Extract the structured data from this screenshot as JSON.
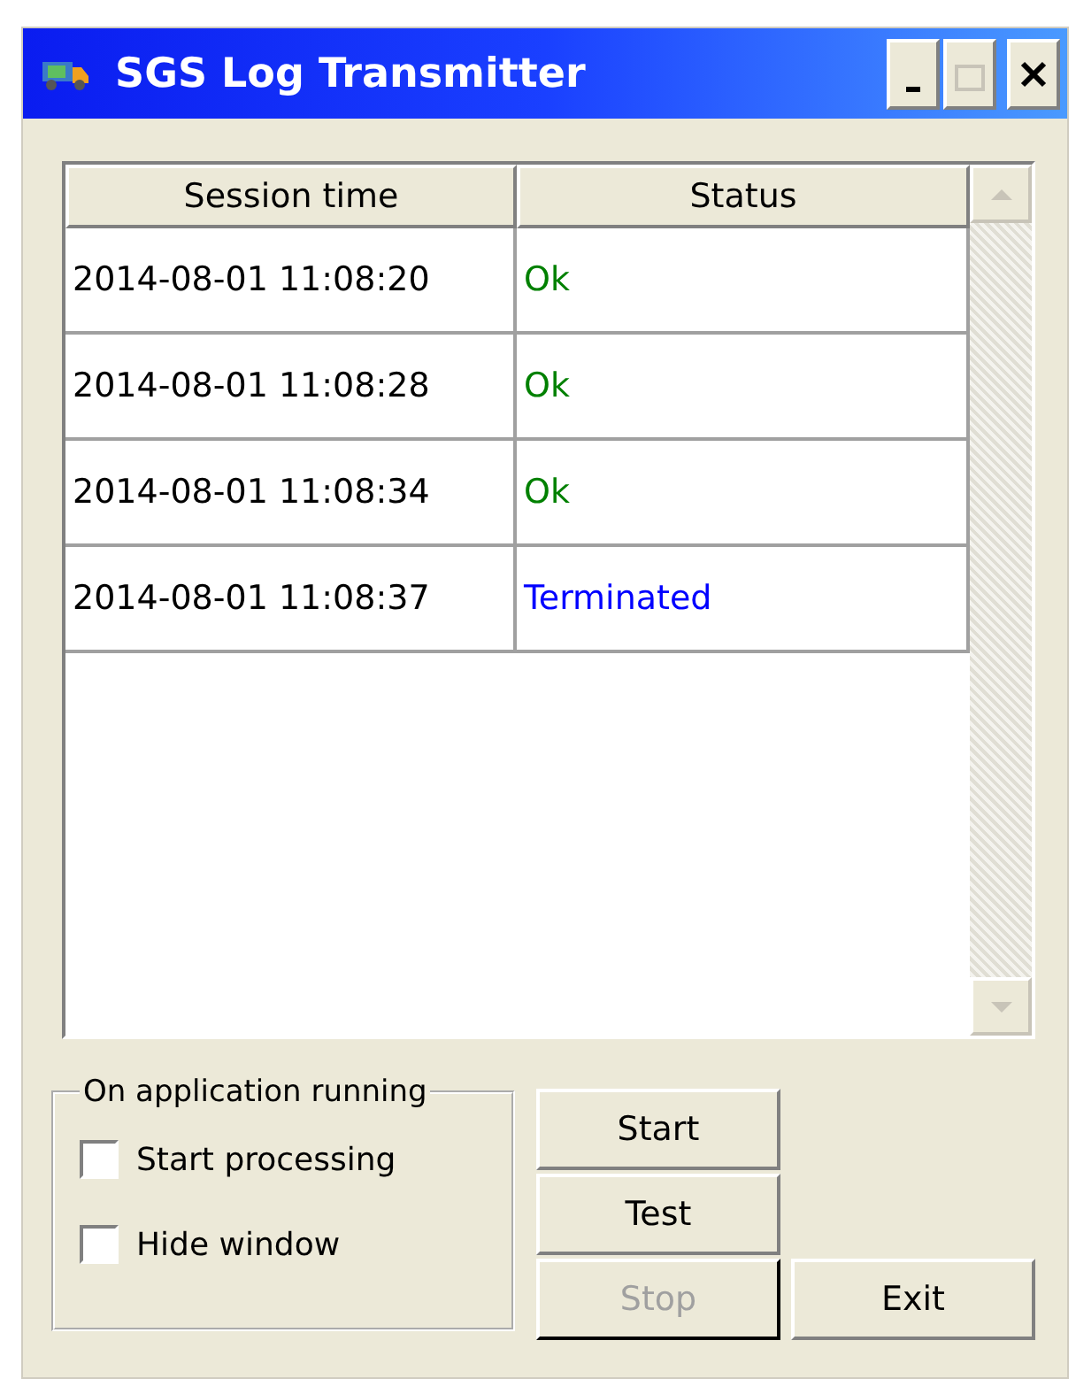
{
  "window": {
    "title": "SGS Log Transmitter"
  },
  "table": {
    "columns": [
      "Session time",
      "Status"
    ],
    "rows": [
      {
        "time": "2014-08-01 11:08:20",
        "status": "Ok",
        "color": "#008000"
      },
      {
        "time": "2014-08-01 11:08:28",
        "status": "Ok",
        "color": "#008000"
      },
      {
        "time": "2014-08-01 11:08:34",
        "status": "Ok",
        "color": "#008000"
      },
      {
        "time": "2014-08-01 11:08:37",
        "status": "Terminated",
        "color": "#0000ff"
      }
    ]
  },
  "options": {
    "title": "On application running",
    "items": [
      {
        "label": "Start processing",
        "checked": false
      },
      {
        "label": "Hide window",
        "checked": false
      }
    ]
  },
  "buttons": [
    {
      "kind": "start",
      "label": "Start",
      "disabled": false
    },
    {
      "kind": "test",
      "label": "Test",
      "disabled": false
    },
    {
      "kind": "stop",
      "label": "Stop",
      "disabled": true
    },
    {
      "kind": "exit",
      "label": "Exit",
      "disabled": false
    }
  ]
}
